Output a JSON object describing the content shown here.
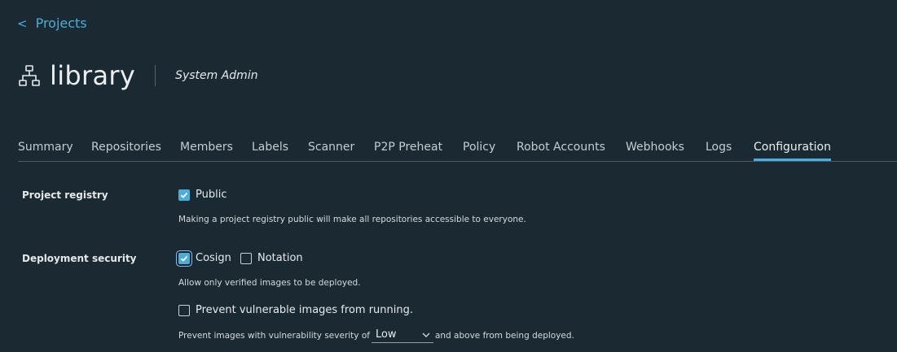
{
  "nav": {
    "back_chevron": "<",
    "back_label": "Projects"
  },
  "header": {
    "icon": "project-hierarchy-icon",
    "title": "library",
    "role": "System Admin"
  },
  "tabs": [
    {
      "label": "Summary"
    },
    {
      "label": "Repositories"
    },
    {
      "label": "Members"
    },
    {
      "label": "Labels"
    },
    {
      "label": "Scanner"
    },
    {
      "label": "P2P Preheat"
    },
    {
      "label": "Policy"
    },
    {
      "label": "Robot Accounts"
    },
    {
      "label": "Webhooks"
    },
    {
      "label": "Logs"
    },
    {
      "label": "Configuration",
      "active": true
    }
  ],
  "config": {
    "project_registry": {
      "label": "Project registry",
      "public_label": "Public",
      "public_checked": true,
      "help": "Making a project registry public will make all repositories accessible to everyone."
    },
    "deployment_security": {
      "label": "Deployment security",
      "cosign_label": "Cosign",
      "cosign_checked": true,
      "notation_label": "Notation",
      "notation_checked": false,
      "help": "Allow only verified images to be deployed.",
      "prevent_label": "Prevent vulnerable images from running.",
      "prevent_checked": false,
      "severity_prefix": "Prevent images with vulnerability severity of",
      "severity_value": "Low",
      "severity_suffix": "and above from being deployed."
    }
  },
  "colors": {
    "accent": "#4aaed9",
    "background": "#1b2a32"
  }
}
